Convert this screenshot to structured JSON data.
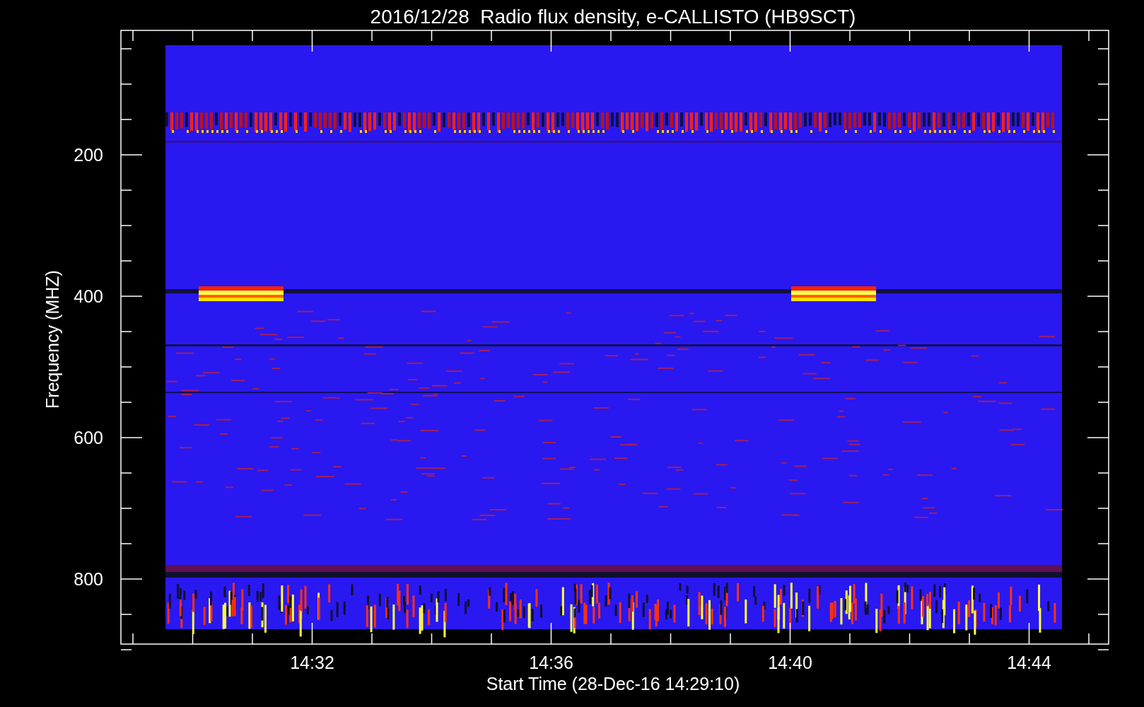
{
  "title": "2016/12/28  Radio flux density, e-CALLISTO (HB9SCT)",
  "plot": {
    "ylabel": "Frequency (MHZ)",
    "yticks": [
      "200",
      "400",
      "600",
      "800"
    ],
    "xlabel": "Start Time (28-Dec-16 14:29:10)",
    "xticks": [
      "14:32",
      "14:36",
      "14:40",
      "14:44"
    ]
  }
}
